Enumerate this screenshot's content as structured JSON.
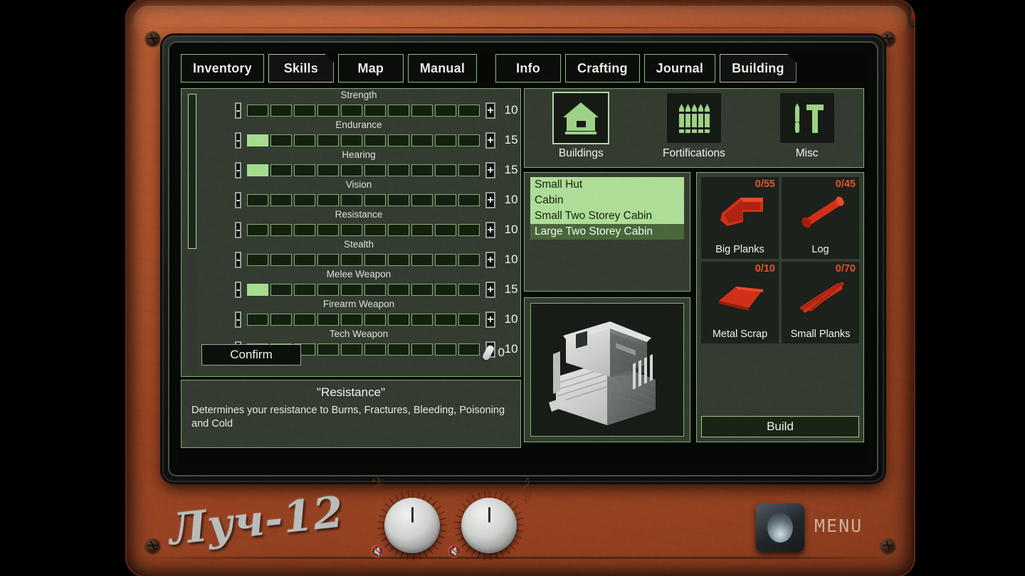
{
  "device": {
    "brand": "Луч-12",
    "menu_label": "MENU",
    "power_switch": "power-rocker-switch"
  },
  "tabs": {
    "left_group": [
      {
        "label": "Inventory",
        "active": false
      },
      {
        "label": "Skills",
        "active": true
      },
      {
        "label": "Map",
        "active": false
      },
      {
        "label": "Manual",
        "active": false
      }
    ],
    "right_group": [
      {
        "label": "Info",
        "active": false
      },
      {
        "label": "Crafting",
        "active": false
      },
      {
        "label": "Journal",
        "active": false
      },
      {
        "label": "Building",
        "active": true
      }
    ]
  },
  "skills": {
    "max_segments": 10,
    "rows": [
      {
        "name": "Strength",
        "value": "10",
        "filled": 0
      },
      {
        "name": "Endurance",
        "value": "15",
        "filled": 1
      },
      {
        "name": "Hearing",
        "value": "15",
        "filled": 1
      },
      {
        "name": "Vision",
        "value": "10",
        "filled": 0
      },
      {
        "name": "Resistance",
        "value": "10",
        "filled": 0
      },
      {
        "name": "Stealth",
        "value": "10",
        "filled": 0
      },
      {
        "name": "Melee Weapon",
        "value": "15",
        "filled": 1
      },
      {
        "name": "Firearm Weapon",
        "value": "10",
        "filled": 0
      },
      {
        "name": "Tech Weapon",
        "value": "10",
        "filled": 0
      }
    ],
    "decrement_label": "-",
    "increment_label": "+",
    "confirm_label": "Confirm",
    "points_available": "0"
  },
  "description": {
    "title": "\"Resistance\"",
    "text": "Determines your resistance to Burns, Fractures, Bleeding, Poisoning and Cold"
  },
  "building": {
    "categories": [
      {
        "label": "Buildings",
        "icon": "house-icon",
        "selected": true
      },
      {
        "label": "Fortifications",
        "icon": "palisade-icon",
        "selected": false
      },
      {
        "label": "Misc",
        "icon": "tools-icon",
        "selected": false
      }
    ],
    "blueprints": [
      {
        "label": "Small Hut",
        "state": "available"
      },
      {
        "label": "Cabin",
        "state": "available"
      },
      {
        "label": "Small Two Storey Cabin",
        "state": "available"
      },
      {
        "label": "Large Two Storey Cabin",
        "state": "selected"
      }
    ],
    "preview_alt": "large-two-storey-cabin-preview",
    "materials": [
      {
        "name": "Big Planks",
        "qty": "0/55",
        "icon": "big-planks-icon"
      },
      {
        "name": "Log",
        "qty": "0/45",
        "icon": "log-icon"
      },
      {
        "name": "Metal Scrap",
        "qty": "0/10",
        "icon": "metal-scrap-icon"
      },
      {
        "name": "Small Planks",
        "qty": "0/70",
        "icon": "small-planks-icon"
      }
    ],
    "build_label": "Build"
  },
  "colors": {
    "panel_green": "#343c31",
    "border_green": "#7fae6f",
    "bar_fill": "#a5dd8f",
    "list_available": "#aedd98",
    "list_selected": "#49673a",
    "material_red": "#e05528",
    "device_copper": "#a94e28"
  }
}
